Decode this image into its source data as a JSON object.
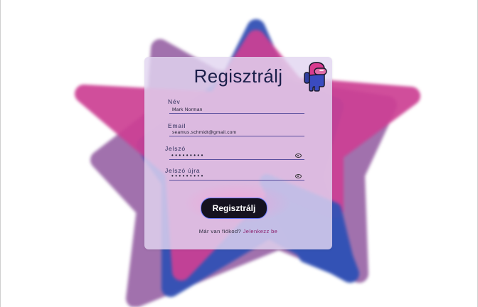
{
  "form": {
    "title": "Regisztrálj",
    "fields": [
      {
        "label": "Név",
        "value": "Mark Norman"
      },
      {
        "label": "Email",
        "value": "seamus.schmidt@gmail.com"
      },
      {
        "label": "Jelszó",
        "value": "•••••••••"
      },
      {
        "label": "Jelszó újra",
        "value": "•••••••••"
      }
    ],
    "submit_label": "Regisztrálj",
    "footer_text": "Már van fiókod?",
    "login_link": "Jelenkezz be"
  },
  "colors": {
    "star_pink": "#cc3f93",
    "star_blue": "#3251b5",
    "star_purple": "#9c6aa9",
    "button": "#15121f"
  },
  "icons": {
    "mascot": "among-us-crewmate-icon",
    "password_toggle": "eye-icon"
  }
}
